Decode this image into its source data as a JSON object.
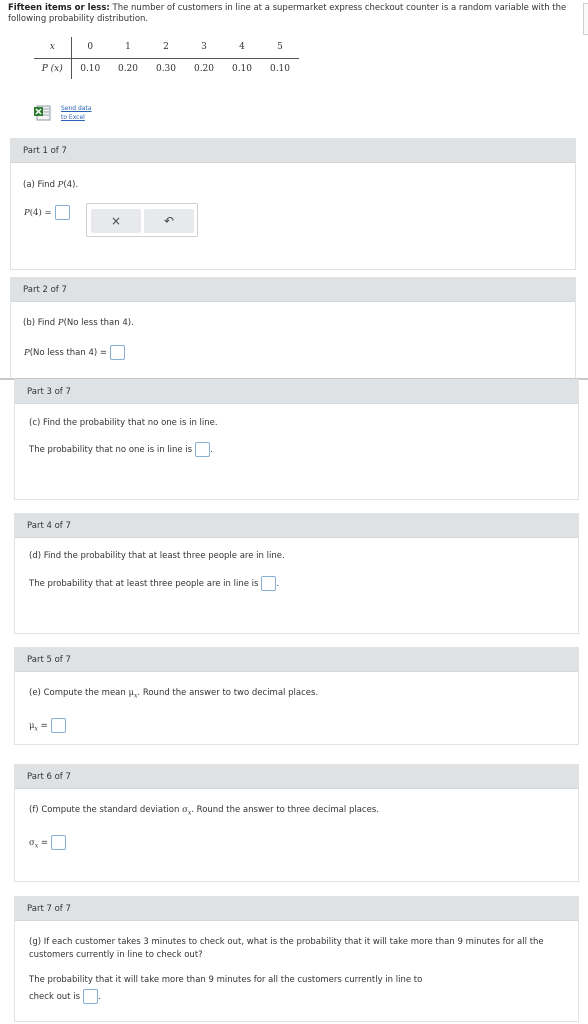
{
  "intro": {
    "bold": "Fifteen items or less:",
    "text": " The number of customers in line at a supermarket express checkout counter is a random variable with the following probability distribution."
  },
  "distribution": {
    "x_label": "x",
    "p_label": "P (x)",
    "x_values": [
      "0",
      "1",
      "2",
      "3",
      "4",
      "5"
    ],
    "p_values": [
      "0.10",
      "0.20",
      "0.30",
      "0.20",
      "0.10",
      "0.10"
    ]
  },
  "excel": {
    "line1": "Send data",
    "line2": "to Excel"
  },
  "parts": [
    {
      "header": "Part 1 of 7",
      "question": "(a) Find P(4).",
      "answer_label": "P(4) ="
    },
    {
      "header": "Part 2 of 7",
      "question": "(b) Find P(No less than 4).",
      "answer_label": "P(No less than 4) ="
    },
    {
      "header": "Part 3 of 7",
      "question": "(c) Find the probability that no one is in line.",
      "answer_label": "The probability that no one is in line is",
      "suffix": "."
    },
    {
      "header": "Part 4 of 7",
      "question": "(d) Find the probability that at least three people are in line.",
      "answer_label": "The probability that at least three people are in line is",
      "suffix": "."
    },
    {
      "header": "Part 5 of 7",
      "question": "(e) Compute the mean μx. Round the answer to two decimal places.",
      "answer_label": "μx ="
    },
    {
      "header": "Part 6 of 7",
      "question": "(f) Compute the standard deviation σx. Round the answer to three decimal places.",
      "answer_label": "σx ="
    },
    {
      "header": "Part 7 of 7",
      "question_line1": "(g) If each customer takes 3 minutes to check out, what is the probability that it will take more than 9 minutes for all the",
      "question_line2": "customers currently in line to check out?",
      "answer_line1": "The probability that it will take more than 9 minutes for all the customers currently in line to",
      "answer_line2": "check out is",
      "suffix": "."
    }
  ],
  "toolbar": {
    "clear_icon": "×",
    "undo_icon": "↶"
  }
}
